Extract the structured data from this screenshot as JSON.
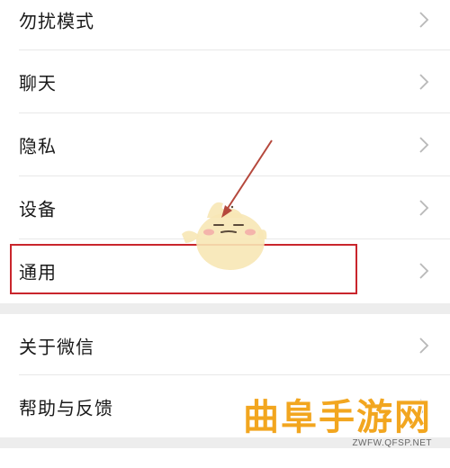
{
  "settings": {
    "items": [
      {
        "label": "勿扰模式",
        "icon": "chevron-right-icon"
      },
      {
        "label": "聊天",
        "icon": "chevron-right-icon"
      },
      {
        "label": "隐私",
        "icon": "chevron-right-icon"
      },
      {
        "label": "设备",
        "icon": "chevron-right-icon"
      },
      {
        "label": "通用",
        "icon": "chevron-right-icon",
        "highlighted": true
      }
    ],
    "items2": [
      {
        "label": "关于微信",
        "icon": "chevron-right-icon"
      },
      {
        "label": "帮助与反馈",
        "icon": "chevron-right-icon"
      }
    ]
  },
  "annotation": {
    "highlight_color": "#c9252c",
    "arrow_color": "#b5483c"
  },
  "watermark": {
    "main": "曲阜手游网",
    "sub": "ZWFW.QFSP.NET",
    "color": "#f2a61f"
  }
}
